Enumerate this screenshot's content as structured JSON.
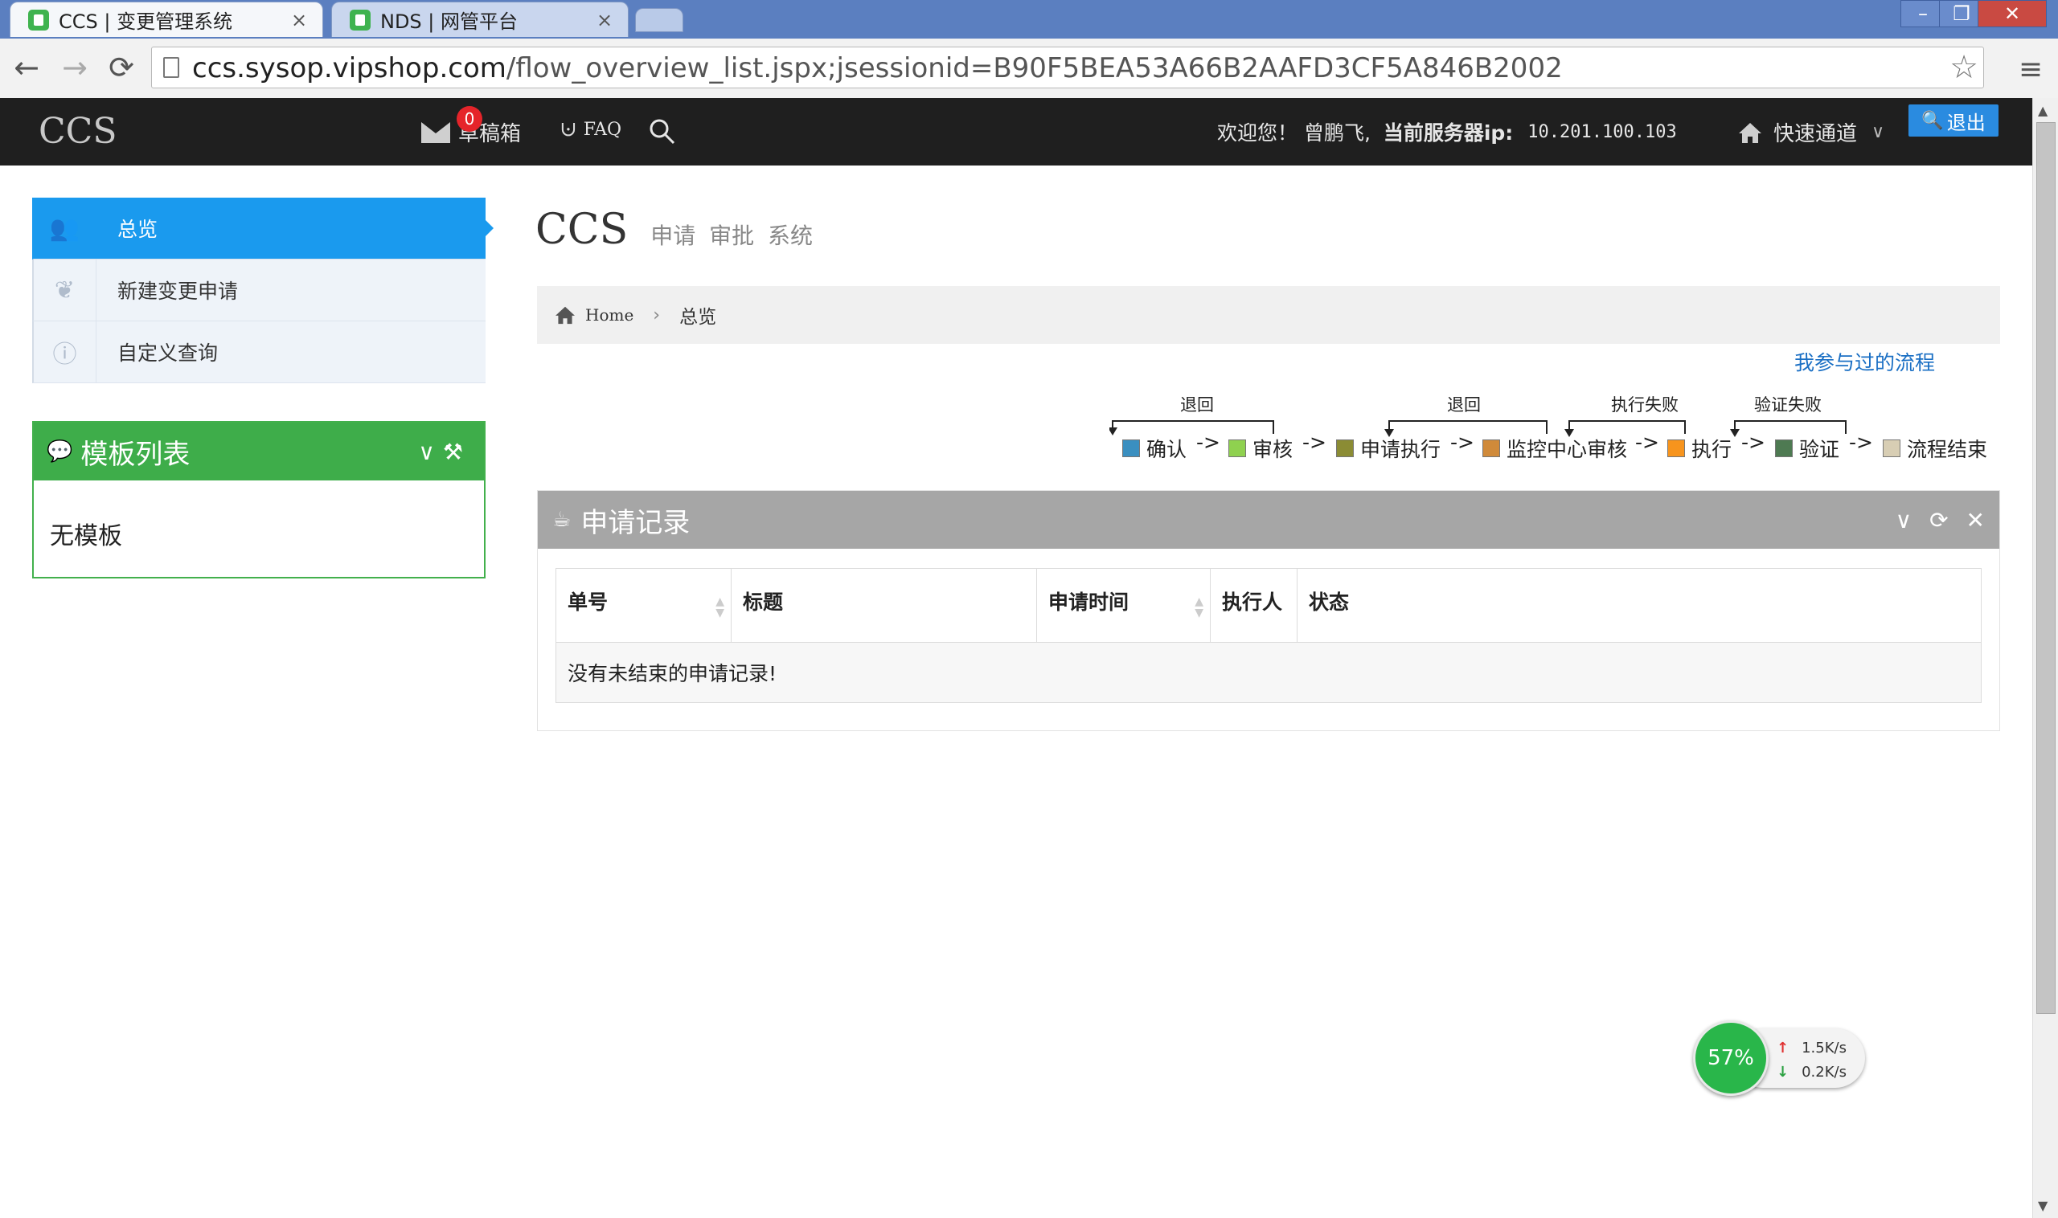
{
  "browser": {
    "tabs": [
      {
        "title": "CCS | 变更管理系统",
        "close": "×"
      },
      {
        "title": "NDS | 网管平台",
        "close": "×"
      }
    ],
    "url_host": "ccs.sysop.vipshop.com",
    "url_path": "/flow_overview_list.jspx;jsessionid=B90F5BEA53A66B2AAFD3CF5A846B2002"
  },
  "header": {
    "brand": "CCS",
    "mail_badge": "0",
    "mail_label": "草稿箱",
    "faq": "FAQ",
    "welcome": "欢迎您！ 曾鹏飞,",
    "server_label": "当前服务器ip:",
    "server_ip": "10.201.100.103",
    "quick_channel": "快速通道",
    "logout": "退出"
  },
  "sidebar": {
    "items": [
      {
        "label": "总览",
        "icon": "users-icon"
      },
      {
        "label": "新建变更申请",
        "icon": "leaf-icon"
      },
      {
        "label": "自定义查询",
        "icon": "info-icon"
      }
    ]
  },
  "templates": {
    "title": "模板列表",
    "empty": "无模板"
  },
  "main": {
    "title": "CCS",
    "subtitle": "申请 审批 系统",
    "breadcrumb": {
      "home": "Home",
      "current": "总览"
    },
    "my_flows_link": "我参与过的流程",
    "flow": {
      "loop_labels": [
        "退回",
        "退回",
        "执行失败",
        "验证失败"
      ],
      "steps": [
        {
          "label": "确认",
          "color": "#3a8fc0"
        },
        {
          "label": "审核",
          "color": "#8fd14f"
        },
        {
          "label": "申请执行",
          "color": "#8b8c34"
        },
        {
          "label": "监控中心审核",
          "color": "#d08a3a"
        },
        {
          "label": "执行",
          "color": "#f7941d"
        },
        {
          "label": "验证",
          "color": "#4e7a52"
        },
        {
          "label": "流程结束",
          "color": "#d8ceb4"
        }
      ],
      "arrow": "->"
    },
    "records": {
      "title": "申请记录",
      "columns": [
        "单号",
        "标题",
        "申请时间",
        "执行人",
        "状态"
      ],
      "empty_message": "没有未结束的申请记录!"
    }
  },
  "net_widget": {
    "percent": "57%",
    "up": "1.5K/s",
    "down": "0.2K/s"
  }
}
